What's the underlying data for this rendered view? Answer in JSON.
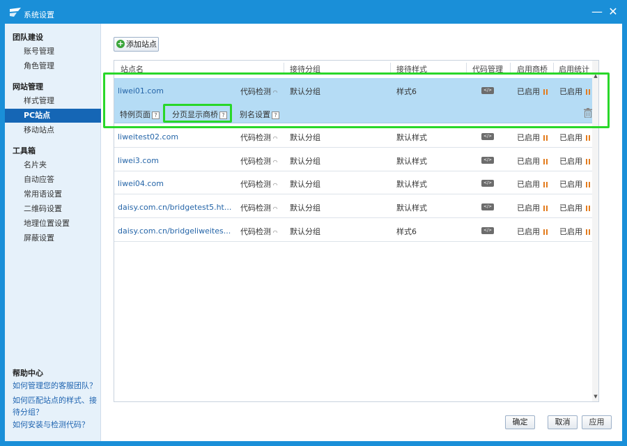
{
  "window": {
    "title": "系统设置",
    "minimize_glyph": "—",
    "close_glyph": "✕"
  },
  "sidebar": {
    "groups": [
      {
        "title": "团队建设",
        "items": [
          "账号管理",
          "角色管理"
        ]
      },
      {
        "title": "网站管理",
        "items": [
          "样式管理",
          "PC站点",
          "移动站点"
        ]
      },
      {
        "title": "工具箱",
        "items": [
          "名片夹",
          "自动应答",
          "常用语设置",
          "二维码设置",
          "地理位置设置",
          "屏蔽设置"
        ]
      }
    ],
    "active_item": "PC站点",
    "help": {
      "title": "帮助中心",
      "links": [
        "如何管理您的客服团队？",
        "如何匹配站点的样式、接待分组？",
        "如何安装与检测代码？"
      ]
    }
  },
  "toolbar": {
    "add_site_label": "添加站点",
    "add_icon": "plus-circle-icon"
  },
  "table": {
    "columns": [
      "站点名",
      "接待分组",
      "接待样式",
      "代码管理",
      "启用商桥",
      "启用统计"
    ],
    "code_check_label": "代码检测",
    "code_button_glyph": "</>",
    "rows": [
      {
        "site": "liwei01.com",
        "group": "默认分组",
        "style": "样式6",
        "bridge": "已启用",
        "stats": "已启用",
        "selected": true
      },
      {
        "site": "liweitest02.com",
        "group": "默认分组",
        "style": "默认样式",
        "bridge": "已启用",
        "stats": "已启用"
      },
      {
        "site": "liwei3.com",
        "group": "默认分组",
        "style": "默认样式",
        "bridge": "已启用",
        "stats": "已启用"
      },
      {
        "site": "liwei04.com",
        "group": "默认分组",
        "style": "默认样式",
        "bridge": "已启用",
        "stats": "已启用"
      },
      {
        "site": "daisy.com.cn/bridgetest5.ht...",
        "group": "默认分组",
        "style": "默认样式",
        "bridge": "已启用",
        "stats": "已启用"
      },
      {
        "site": "daisy.com.cn/bridgeliweites...",
        "group": "默认分组",
        "style": "样式6",
        "bridge": "已启用",
        "stats": "已启用"
      }
    ],
    "selected_actions": {
      "special_page": "特例页面",
      "page_bridge": "分页显示商桥",
      "alias": "别名设置",
      "help_glyph": "?"
    }
  },
  "footer": {
    "ok": "确定",
    "cancel": "取消",
    "apply": "应用"
  },
  "colors": {
    "accent": "#1a8fd8",
    "active_nav": "#1566b5",
    "highlight": "#29d729",
    "selected_row": "#b5dcf5",
    "status_icon": "#e37b1c"
  }
}
